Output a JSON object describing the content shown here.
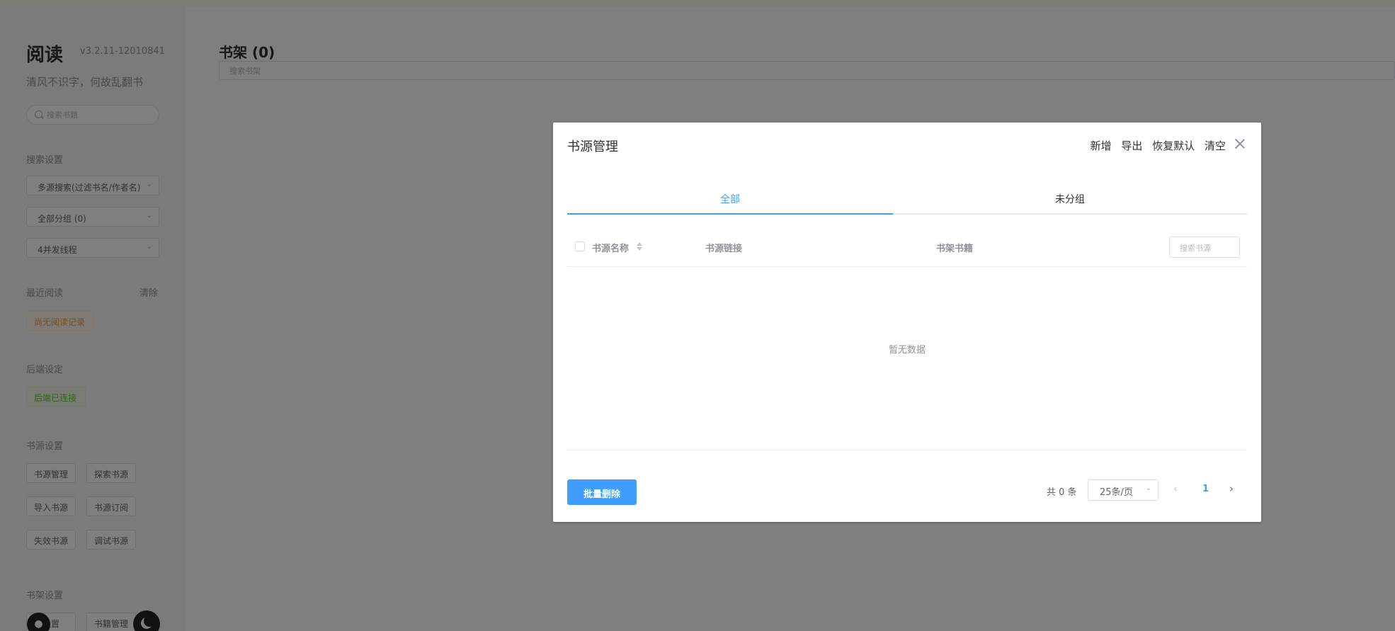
{
  "sidebar": {
    "app_title": "阅读",
    "app_version": "v3.2.11-12010841",
    "tagline": "清风不识字，何故乱翻书",
    "search_placeholder": "搜索书籍",
    "search_settings": {
      "title": "搜索设置",
      "source_mode": "多源搜索(过滤书名/作者名)",
      "group": "全部分组 (0)",
      "threads": "4并发线程"
    },
    "recent": {
      "title": "最近阅读",
      "clear_label": "清除",
      "empty_tag": "尚无阅读记录"
    },
    "backend": {
      "title": "后端设定",
      "status_tag": "后端已连接"
    },
    "source_settings": {
      "title": "书源设置",
      "buttons": [
        "书源管理",
        "探索书源",
        "导入书源",
        "书源订阅",
        "失效书源",
        "调试书源"
      ]
    },
    "shelf_settings": {
      "title": "书架设置",
      "buttons": [
        "设置",
        "书籍管理"
      ]
    }
  },
  "main": {
    "shelf_title": "书架 (0)",
    "shelf_search_placeholder": "搜索书架"
  },
  "dialog": {
    "title": "书源管理",
    "actions": [
      "新增",
      "导出",
      "恢复默认",
      "清空"
    ],
    "tabs": [
      {
        "label": "全部",
        "active": true
      },
      {
        "label": "未分组",
        "active": false
      }
    ],
    "columns": [
      "书源名称",
      "书源链接",
      "书架书籍"
    ],
    "table_search_placeholder": "搜索书源",
    "empty_text": "暂无数据",
    "batch_delete_label": "批量删除",
    "total_label": "共 0 条",
    "page_size": "25条/页",
    "current_page": "1"
  },
  "colors": {
    "accent": "#409eff",
    "warning": "#e6a23c",
    "success": "#67c23a"
  }
}
